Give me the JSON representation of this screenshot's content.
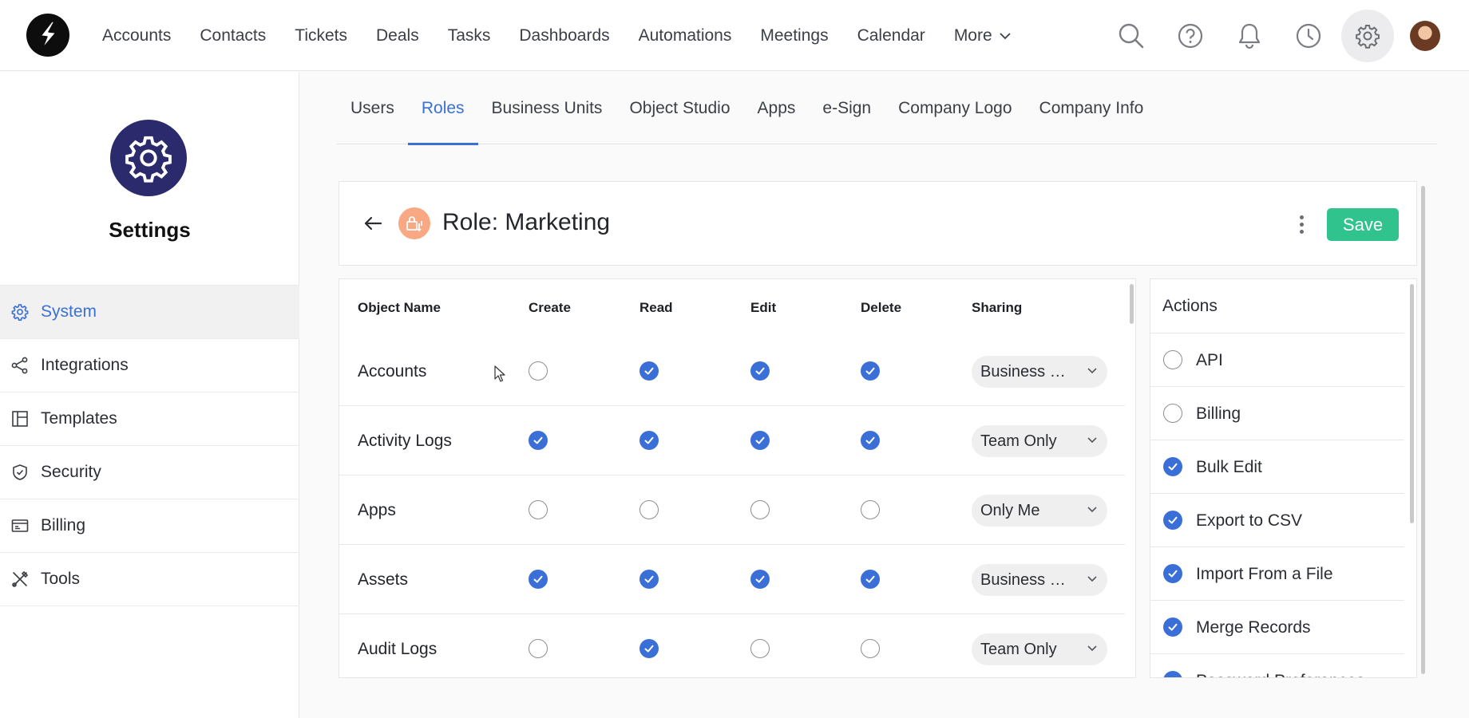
{
  "nav": {
    "links": [
      "Accounts",
      "Contacts",
      "Tickets",
      "Deals",
      "Tasks",
      "Dashboards",
      "Automations",
      "Meetings",
      "Calendar"
    ],
    "more_label": "More",
    "icons": [
      "search-icon",
      "help-icon",
      "bell-icon",
      "clock-icon",
      "gear-icon"
    ]
  },
  "sidebar": {
    "title": "Settings",
    "items": [
      {
        "label": "System",
        "icon": "gear-icon",
        "active": true
      },
      {
        "label": "Integrations",
        "icon": "share-icon",
        "active": false
      },
      {
        "label": "Templates",
        "icon": "layout-icon",
        "active": false
      },
      {
        "label": "Security",
        "icon": "shield-icon",
        "active": false
      },
      {
        "label": "Billing",
        "icon": "card-icon",
        "active": false
      },
      {
        "label": "Tools",
        "icon": "tools-icon",
        "active": false
      }
    ]
  },
  "tabs": [
    {
      "label": "Users",
      "active": false
    },
    {
      "label": "Roles",
      "active": true
    },
    {
      "label": "Business Units",
      "active": false
    },
    {
      "label": "Object Studio",
      "active": false
    },
    {
      "label": "Apps",
      "active": false
    },
    {
      "label": "e-Sign",
      "active": false
    },
    {
      "label": "Company Logo",
      "active": false
    },
    {
      "label": "Company Info",
      "active": false
    }
  ],
  "role": {
    "title": "Role: Marketing",
    "save_label": "Save"
  },
  "permissions": {
    "headers": {
      "name": "Object Name",
      "create": "Create",
      "read": "Read",
      "edit": "Edit",
      "delete": "Delete",
      "sharing": "Sharing"
    },
    "rows": [
      {
        "name": "Accounts",
        "create": false,
        "read": true,
        "edit": true,
        "delete": true,
        "sharing": "Business Unit"
      },
      {
        "name": "Activity Logs",
        "create": true,
        "read": true,
        "edit": true,
        "delete": true,
        "sharing": "Team Only"
      },
      {
        "name": "Apps",
        "create": false,
        "read": false,
        "edit": false,
        "delete": false,
        "sharing": "Only Me"
      },
      {
        "name": "Assets",
        "create": true,
        "read": true,
        "edit": true,
        "delete": true,
        "sharing": "Business Unit"
      },
      {
        "name": "Audit Logs",
        "create": false,
        "read": true,
        "edit": false,
        "delete": false,
        "sharing": "Team Only"
      }
    ]
  },
  "actions": {
    "title": "Actions",
    "items": [
      {
        "label": "API",
        "checked": false
      },
      {
        "label": "Billing",
        "checked": false
      },
      {
        "label": "Bulk Edit",
        "checked": true
      },
      {
        "label": "Export to CSV",
        "checked": true
      },
      {
        "label": "Import From a File",
        "checked": true
      },
      {
        "label": "Merge Records",
        "checked": true
      },
      {
        "label": "Password Preferences",
        "checked": true
      }
    ]
  },
  "colors": {
    "accent": "#3b6fd8",
    "save": "#30c38d",
    "settings_badge": "#2a2a6c",
    "role_icon": "#f8a883"
  }
}
